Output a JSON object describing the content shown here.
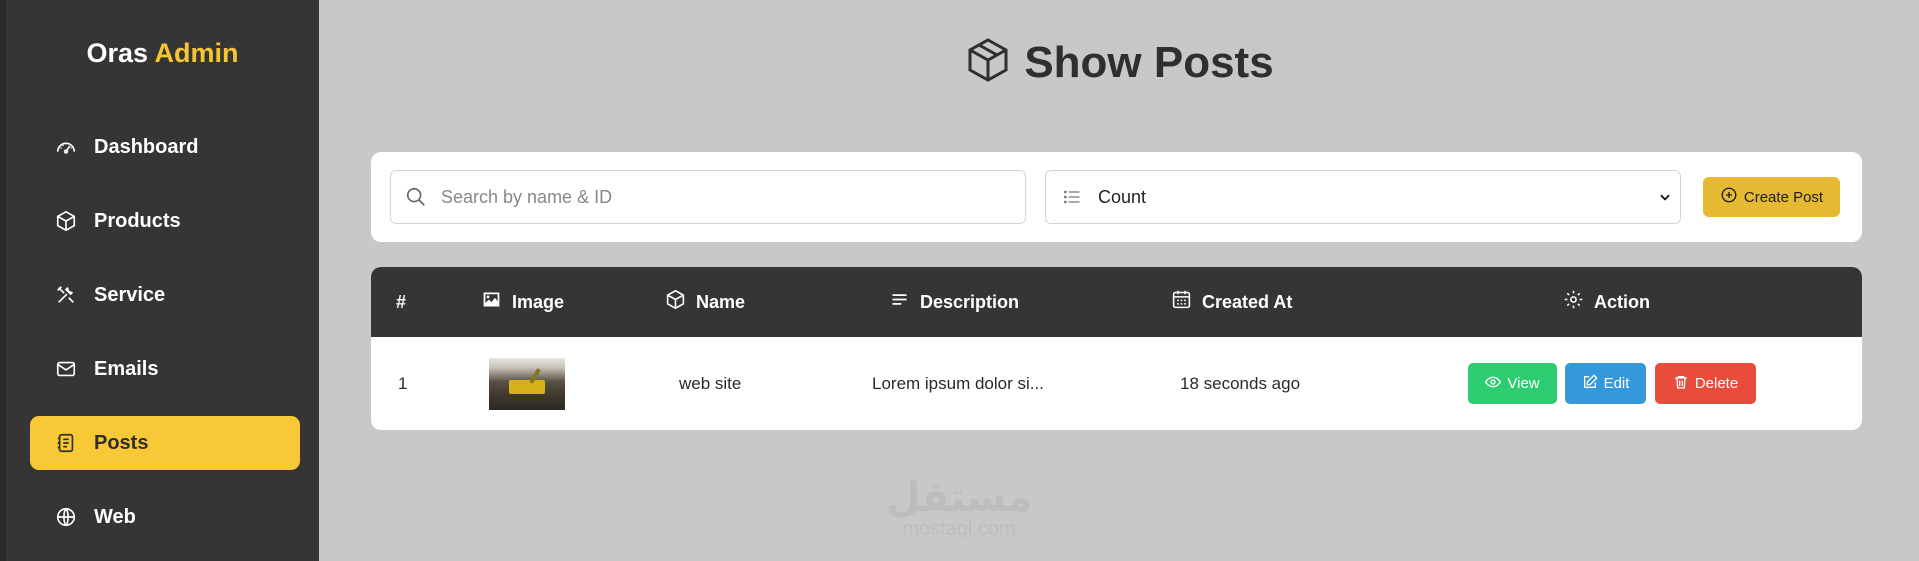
{
  "brand": {
    "name": "Oras",
    "accent": "Admin",
    "accent_color": "#f8c531"
  },
  "sidebar": {
    "items": [
      {
        "label": "Dashboard",
        "icon": "gauge-icon",
        "active": false
      },
      {
        "label": "Products",
        "icon": "box-icon",
        "active": false
      },
      {
        "label": "Service",
        "icon": "tools-icon",
        "active": false
      },
      {
        "label": "Emails",
        "icon": "envelope-icon",
        "active": false
      },
      {
        "label": "Posts",
        "icon": "journal-icon",
        "active": true
      },
      {
        "label": "Web",
        "icon": "globe-icon",
        "active": false
      }
    ]
  },
  "page": {
    "title": "Show Posts",
    "title_icon": "box-icon"
  },
  "toolbar": {
    "search_placeholder": "Search by name & ID",
    "search_value": "",
    "select_value": "Count",
    "create_label": "Create Post"
  },
  "table": {
    "headers": {
      "index": "#",
      "image": "Image",
      "name": "Name",
      "description": "Description",
      "created_at": "Created At",
      "action": "Action"
    },
    "rows": [
      {
        "index": "1",
        "name": "web site",
        "description": "Lorem ipsum dolor si...",
        "created_at": "18 seconds ago"
      }
    ],
    "actions": {
      "view": "View",
      "edit": "Edit",
      "delete": "Delete"
    }
  },
  "watermark": {
    "line1": "مستقل",
    "line2": "mostaql.com"
  },
  "colors": {
    "sidebar_bg": "#353535",
    "active_item": "#f8c836",
    "create_button": "#e5b931",
    "view_button": "#2ecc71",
    "edit_button": "#3498db",
    "delete_button": "#e74c3c"
  }
}
